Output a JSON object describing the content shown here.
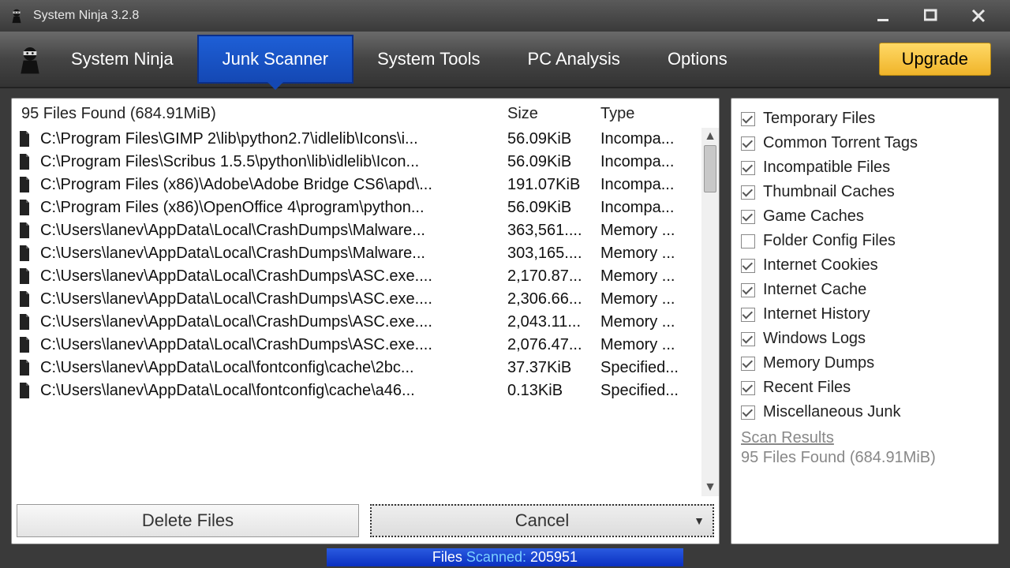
{
  "window": {
    "title": "System Ninja 3.2.8"
  },
  "nav": {
    "brand": "System Ninja",
    "items": [
      "Junk Scanner",
      "System Tools",
      "PC Analysis",
      "Options"
    ],
    "active_index": 0,
    "upgrade": "Upgrade"
  },
  "grid": {
    "summary": "95 Files Found (684.91MiB)",
    "columns": {
      "size": "Size",
      "type": "Type"
    },
    "rows": [
      {
        "path": "C:\\Program Files\\GIMP 2\\lib\\python2.7\\idlelib\\Icons\\i...",
        "size": "56.09KiB",
        "type": "Incompa..."
      },
      {
        "path": "C:\\Program Files\\Scribus 1.5.5\\python\\lib\\idlelib\\Icon...",
        "size": "56.09KiB",
        "type": "Incompa..."
      },
      {
        "path": "C:\\Program Files (x86)\\Adobe\\Adobe Bridge CS6\\apd\\...",
        "size": "191.07KiB",
        "type": "Incompa..."
      },
      {
        "path": "C:\\Program Files (x86)\\OpenOffice 4\\program\\python...",
        "size": "56.09KiB",
        "type": "Incompa..."
      },
      {
        "path": "C:\\Users\\lanev\\AppData\\Local\\CrashDumps\\Malware...",
        "size": "363,561....",
        "type": "Memory ..."
      },
      {
        "path": "C:\\Users\\lanev\\AppData\\Local\\CrashDumps\\Malware...",
        "size": "303,165....",
        "type": "Memory ..."
      },
      {
        "path": "C:\\Users\\lanev\\AppData\\Local\\CrashDumps\\ASC.exe....",
        "size": "2,170.87...",
        "type": "Memory ..."
      },
      {
        "path": "C:\\Users\\lanev\\AppData\\Local\\CrashDumps\\ASC.exe....",
        "size": "2,306.66...",
        "type": "Memory ..."
      },
      {
        "path": "C:\\Users\\lanev\\AppData\\Local\\CrashDumps\\ASC.exe....",
        "size": "2,043.11...",
        "type": "Memory ..."
      },
      {
        "path": "C:\\Users\\lanev\\AppData\\Local\\CrashDumps\\ASC.exe....",
        "size": "2,076.47...",
        "type": "Memory ..."
      },
      {
        "path": "C:\\Users\\lanev\\AppData\\Local\\fontconfig\\cache\\2bc...",
        "size": "37.37KiB",
        "type": "Specified..."
      },
      {
        "path": "C:\\Users\\lanev\\AppData\\Local\\fontconfig\\cache\\a46...",
        "size": "0.13KiB",
        "type": "Specified..."
      }
    ]
  },
  "actions": {
    "delete": "Delete Files",
    "cancel": "Cancel"
  },
  "categories": [
    {
      "label": "Temporary Files",
      "checked": true
    },
    {
      "label": "Common Torrent Tags",
      "checked": true
    },
    {
      "label": "Incompatible Files",
      "checked": true
    },
    {
      "label": "Thumbnail Caches",
      "checked": true
    },
    {
      "label": "Game Caches",
      "checked": true
    },
    {
      "label": "Folder Config Files",
      "checked": false
    },
    {
      "label": "Internet Cookies",
      "checked": true
    },
    {
      "label": "Internet Cache",
      "checked": true
    },
    {
      "label": "Internet History",
      "checked": true
    },
    {
      "label": "Windows Logs",
      "checked": true
    },
    {
      "label": "Memory Dumps",
      "checked": true
    },
    {
      "label": "Recent Files",
      "checked": true
    },
    {
      "label": "Miscellaneous Junk",
      "checked": true
    }
  ],
  "scan_results": {
    "heading": "Scan Results",
    "summary": "95 Files Found (684.91MiB)"
  },
  "status": {
    "label_prefix": "Files ",
    "label_mid": "Scanned:",
    "count": "205951"
  }
}
